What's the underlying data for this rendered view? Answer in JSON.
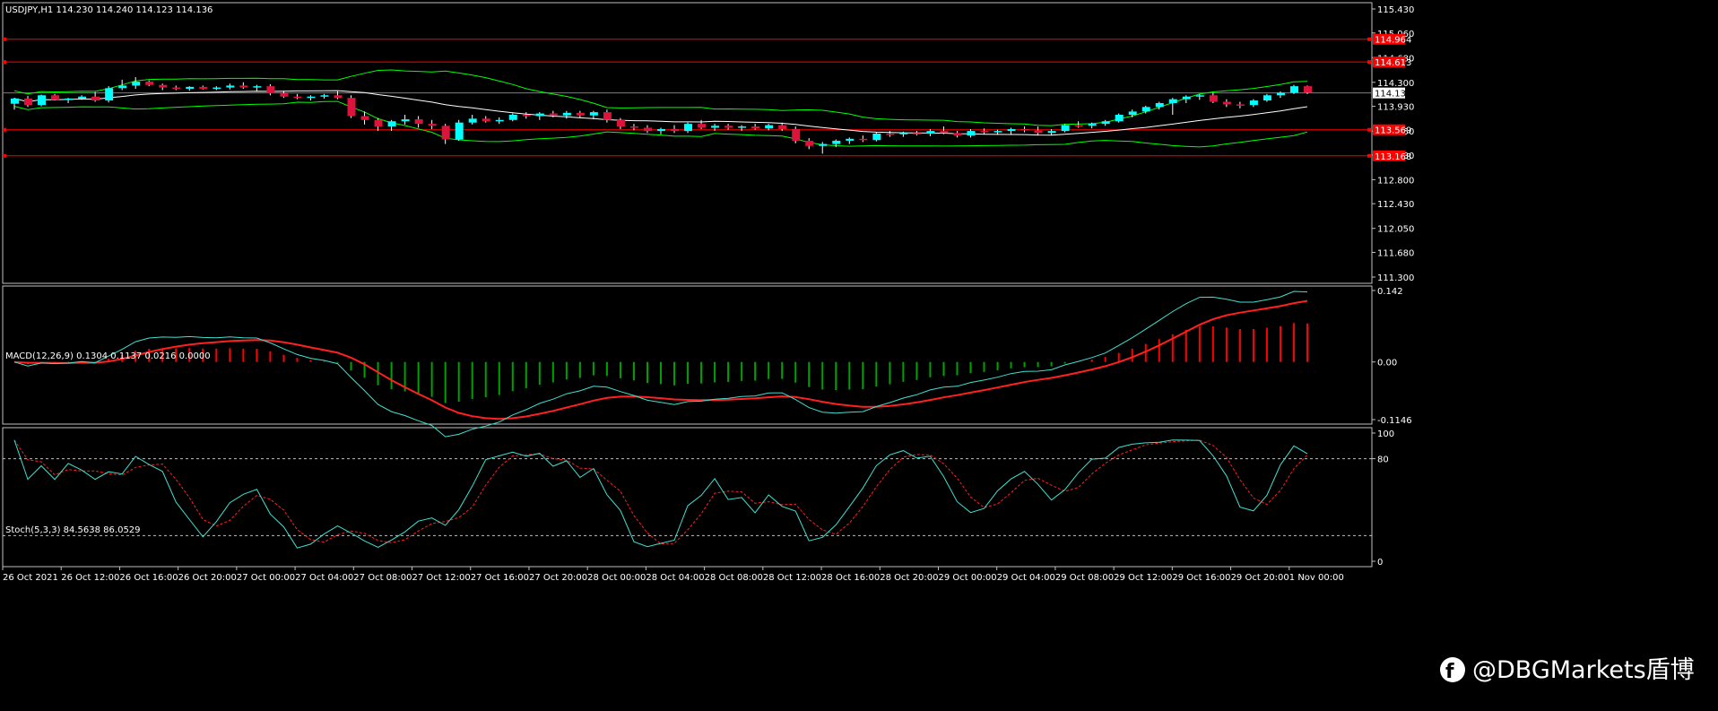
{
  "chart_data": [
    {
      "type": "candlestick",
      "symbol_header": "USDJPY,H1  114.230 114.240 114.123 114.136",
      "ylim": [
        111.3,
        115.43
      ],
      "y_ticks": [
        "115.430",
        "115.060",
        "114.680",
        "114.300",
        "113.930",
        "113.550",
        "113.180",
        "112.800",
        "112.430",
        "112.050",
        "111.680",
        "111.300"
      ],
      "current_price": "114.136",
      "horizontal_levels": [
        "114.964",
        "114.613",
        "113.569",
        "113.168"
      ],
      "up_color": "#00ffff",
      "down_color": "#dc143c",
      "candles": [
        [
          113.97,
          114.06,
          113.88,
          114.05
        ],
        [
          114.05,
          114.09,
          113.92,
          113.95
        ],
        [
          113.95,
          114.11,
          113.93,
          114.1
        ],
        [
          114.1,
          114.12,
          114.02,
          114.03
        ],
        [
          114.03,
          114.06,
          113.98,
          114.05
        ],
        [
          114.05,
          114.1,
          114.03,
          114.08
        ],
        [
          114.08,
          114.15,
          114.0,
          114.02
        ],
        [
          114.02,
          114.24,
          113.99,
          114.21
        ],
        [
          114.21,
          114.34,
          114.18,
          114.25
        ],
        [
          114.25,
          114.38,
          114.2,
          114.31
        ],
        [
          114.31,
          114.33,
          114.24,
          114.26
        ],
        [
          114.26,
          114.28,
          114.18,
          114.22
        ],
        [
          114.22,
          114.25,
          114.18,
          114.2
        ],
        [
          114.2,
          114.24,
          114.17,
          114.23
        ],
        [
          114.23,
          114.25,
          114.19,
          114.2
        ],
        [
          114.2,
          114.24,
          114.18,
          114.22
        ],
        [
          114.22,
          114.28,
          114.19,
          114.25
        ],
        [
          114.25,
          114.3,
          114.2,
          114.22
        ],
        [
          114.22,
          114.26,
          114.16,
          114.24
        ],
        [
          114.24,
          114.27,
          114.1,
          114.13
        ],
        [
          114.13,
          114.17,
          114.06,
          114.08
        ],
        [
          114.08,
          114.12,
          114.04,
          114.06
        ],
        [
          114.06,
          114.1,
          114.02,
          114.08
        ],
        [
          114.08,
          114.12,
          114.05,
          114.1
        ],
        [
          114.1,
          114.16,
          114.04,
          114.06
        ],
        [
          114.06,
          114.1,
          113.75,
          113.78
        ],
        [
          113.78,
          113.85,
          113.65,
          113.72
        ],
        [
          113.72,
          113.75,
          113.55,
          113.62
        ],
        [
          113.62,
          113.72,
          113.55,
          113.7
        ],
        [
          113.7,
          113.8,
          113.65,
          113.73
        ],
        [
          113.73,
          113.78,
          113.6,
          113.66
        ],
        [
          113.66,
          113.72,
          113.58,
          113.63
        ],
        [
          113.63,
          113.66,
          113.35,
          113.42
        ],
        [
          113.42,
          113.72,
          113.4,
          113.68
        ],
        [
          113.68,
          113.8,
          113.65,
          113.74
        ],
        [
          113.74,
          113.78,
          113.68,
          113.7
        ],
        [
          113.7,
          113.76,
          113.66,
          113.72
        ],
        [
          113.72,
          113.82,
          113.7,
          113.8
        ],
        [
          113.8,
          113.84,
          113.74,
          113.78
        ],
        [
          113.78,
          113.84,
          113.72,
          113.82
        ],
        [
          113.82,
          113.86,
          113.76,
          113.79
        ],
        [
          113.79,
          113.86,
          113.74,
          113.83
        ],
        [
          113.83,
          113.86,
          113.76,
          113.79
        ],
        [
          113.79,
          113.86,
          113.73,
          113.84
        ],
        [
          113.84,
          113.88,
          113.68,
          113.72
        ],
        [
          113.72,
          113.75,
          113.58,
          113.62
        ],
        [
          113.62,
          113.66,
          113.56,
          113.6
        ],
        [
          113.6,
          113.64,
          113.52,
          113.55
        ],
        [
          113.55,
          113.6,
          113.5,
          113.58
        ],
        [
          113.58,
          113.64,
          113.52,
          113.55
        ],
        [
          113.55,
          113.68,
          113.52,
          113.66
        ],
        [
          113.66,
          113.72,
          113.58,
          113.6
        ],
        [
          113.6,
          113.66,
          113.55,
          113.63
        ],
        [
          113.63,
          113.66,
          113.57,
          113.6
        ],
        [
          113.6,
          113.64,
          113.55,
          113.62
        ],
        [
          113.62,
          113.66,
          113.57,
          113.59
        ],
        [
          113.59,
          113.66,
          113.56,
          113.64
        ],
        [
          113.64,
          113.68,
          113.55,
          113.58
        ],
        [
          113.58,
          113.62,
          113.36,
          113.4
        ],
        [
          113.4,
          113.44,
          113.27,
          113.32
        ],
        [
          113.32,
          113.38,
          113.2,
          113.35
        ],
        [
          113.35,
          113.42,
          113.3,
          113.4
        ],
        [
          113.4,
          113.45,
          113.35,
          113.43
        ],
        [
          113.43,
          113.48,
          113.38,
          113.41
        ],
        [
          113.41,
          113.53,
          113.39,
          113.51
        ],
        [
          113.51,
          113.55,
          113.46,
          113.5
        ],
        [
          113.5,
          113.54,
          113.46,
          113.52
        ],
        [
          113.52,
          113.55,
          113.48,
          113.51
        ],
        [
          113.51,
          113.58,
          113.47,
          113.55
        ],
        [
          113.55,
          113.62,
          113.5,
          113.52
        ],
        [
          113.52,
          113.55,
          113.45,
          113.48
        ],
        [
          113.48,
          113.58,
          113.45,
          113.55
        ],
        [
          113.55,
          113.59,
          113.5,
          113.53
        ],
        [
          113.53,
          113.57,
          113.49,
          113.55
        ],
        [
          113.55,
          113.6,
          113.5,
          113.58
        ],
        [
          113.58,
          113.62,
          113.53,
          113.56
        ],
        [
          113.56,
          113.62,
          113.48,
          113.52
        ],
        [
          113.52,
          113.58,
          113.49,
          113.55
        ],
        [
          113.55,
          113.66,
          113.53,
          113.64
        ],
        [
          113.64,
          113.7,
          113.6,
          113.63
        ],
        [
          113.63,
          113.68,
          113.59,
          113.66
        ],
        [
          113.66,
          113.72,
          113.63,
          113.7
        ],
        [
          113.7,
          113.82,
          113.68,
          113.8
        ],
        [
          113.8,
          113.88,
          113.76,
          113.85
        ],
        [
          113.85,
          113.94,
          113.82,
          113.92
        ],
        [
          113.92,
          114.0,
          113.88,
          113.98
        ],
        [
          113.98,
          114.06,
          113.8,
          114.04
        ],
        [
          114.04,
          114.1,
          113.98,
          114.08
        ],
        [
          114.08,
          114.12,
          114.03,
          114.1
        ],
        [
          114.1,
          114.14,
          113.98,
          114.0
        ],
        [
          114.0,
          114.04,
          113.92,
          113.96
        ],
        [
          113.96,
          114.0,
          113.9,
          113.95
        ],
        [
          113.95,
          114.04,
          113.92,
          114.02
        ],
        [
          114.02,
          114.12,
          114.0,
          114.1
        ],
        [
          114.1,
          114.16,
          114.06,
          114.14
        ],
        [
          114.14,
          114.26,
          114.12,
          114.24
        ],
        [
          114.24,
          114.25,
          114.12,
          114.14
        ]
      ],
      "bollinger": {
        "middle_color": "#ffffff",
        "band_color": "#00ff00"
      },
      "x_ticks": [
        "26 Oct 2021",
        "26 Oct 12:00",
        "26 Oct 16:00",
        "26 Oct 20:00",
        "27 Oct 00:00",
        "27 Oct 04:00",
        "27 Oct 08:00",
        "27 Oct 12:00",
        "27 Oct 16:00",
        "27 Oct 20:00",
        "28 Oct 00:00",
        "28 Oct 04:00",
        "28 Oct 08:00",
        "28 Oct 12:00",
        "28 Oct 16:00",
        "28 Oct 20:00",
        "29 Oct 00:00",
        "29 Oct 04:00",
        "29 Oct 08:00",
        "29 Oct 12:00",
        "29 Oct 16:00",
        "29 Oct 20:00",
        "1 Nov 00:00"
      ]
    },
    {
      "type": "macd",
      "header": "MACD(12,26,9) 0.1304 0.1137 0.0216 0.0000",
      "ylim": [
        -0.1146,
        0.142
      ],
      "y_ticks": [
        "0.142",
        "0.00",
        "-0.1146"
      ],
      "macd_color": "#40e0d0",
      "signal_color": "#ff2020",
      "hist_pos_color": "#ff0000",
      "hist_neg_color": "#00a000"
    },
    {
      "type": "stochastic",
      "header": "Stoch(5,3,3) 84.5638 86.0529",
      "ylim": [
        0,
        100
      ],
      "y_ticks": [
        "100",
        "80",
        "0"
      ],
      "levels": [
        80,
        20
      ],
      "k_color": "#40e0d0",
      "d_color": "#ff2020"
    }
  ],
  "watermark": "@DBGMarkets盾博"
}
